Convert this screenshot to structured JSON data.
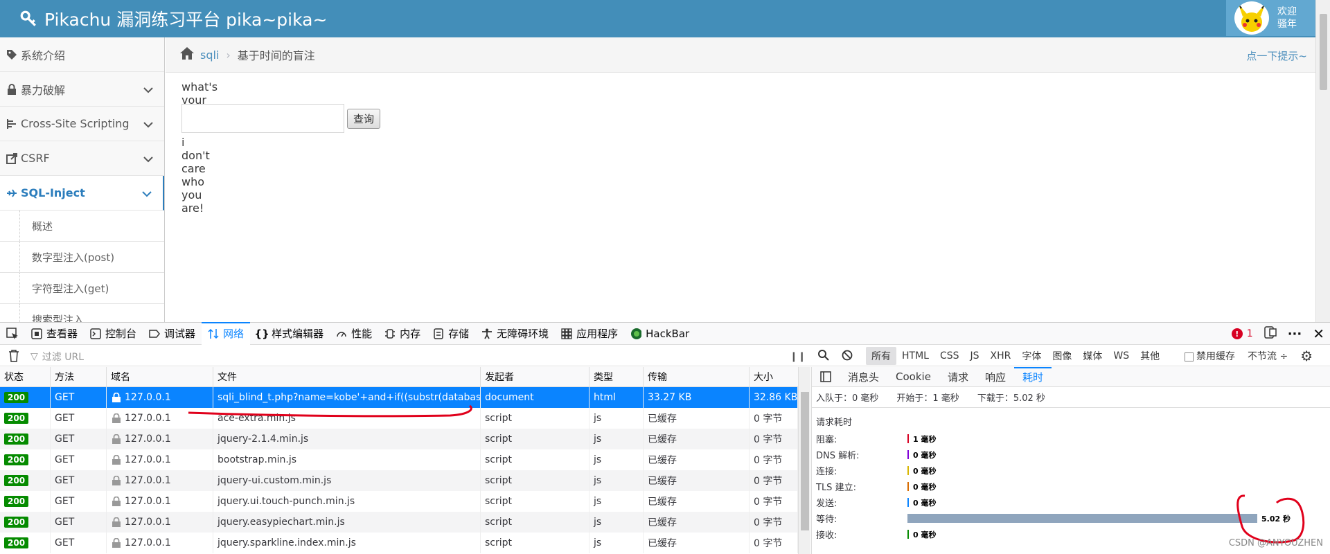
{
  "header": {
    "title": "Pikachu 漏洞练习平台 pika~pika~",
    "welcome": "欢迎",
    "username": "骚年"
  },
  "sidebar": {
    "items": [
      {
        "label": "系统介绍",
        "icon": "tags-icon"
      },
      {
        "label": "暴力破解",
        "icon": "lock-icon"
      },
      {
        "label": "Cross-Site Scripting",
        "icon": "list-icon"
      },
      {
        "label": "CSRF",
        "icon": "external-link-icon"
      },
      {
        "label": "SQL-Inject",
        "icon": "plane-icon"
      }
    ],
    "subitems": [
      "概述",
      "数字型注入(post)",
      "字符型注入(get)",
      "搜索型注入"
    ]
  },
  "breadcrumb": {
    "link": "sqli",
    "current": "基于时间的盲注",
    "hint": "点一下提示~"
  },
  "content": {
    "question": "what's your username?",
    "input_value": "",
    "button": "查询",
    "result": "i don't care who you are!"
  },
  "devtools": {
    "tabs": [
      "查看器",
      "控制台",
      "调试器",
      "网络",
      "样式编辑器",
      "性能",
      "内存",
      "存储",
      "无障碍环境",
      "应用程序",
      "HackBar"
    ],
    "active_tab": "网络",
    "error_count": "1",
    "filter_placeholder": "过滤 URL",
    "type_filters": [
      "所有",
      "HTML",
      "CSS",
      "JS",
      "XHR",
      "字体",
      "图像",
      "媒体",
      "WS",
      "其他"
    ],
    "disable_cache": "禁用缓存",
    "throttle": "不节流 ÷",
    "columns": [
      "状态",
      "方法",
      "域名",
      "文件",
      "发起者",
      "类型",
      "传输",
      "大小"
    ],
    "rows": [
      {
        "status": "200",
        "method": "GET",
        "domain": "127.0.0.1",
        "file": "sqli_blind_t.php?name=kobe'+and+if((substr(databas",
        "initiator": "document",
        "type": "html",
        "transfer": "33.27 KB",
        "size": "32.86 KB"
      },
      {
        "status": "200",
        "method": "GET",
        "domain": "127.0.0.1",
        "file": "ace-extra.min.js",
        "initiator": "script",
        "type": "js",
        "transfer": "已缓存",
        "size": "0 字节"
      },
      {
        "status": "200",
        "method": "GET",
        "domain": "127.0.0.1",
        "file": "jquery-2.1.4.min.js",
        "initiator": "script",
        "type": "js",
        "transfer": "已缓存",
        "size": "0 字节"
      },
      {
        "status": "200",
        "method": "GET",
        "domain": "127.0.0.1",
        "file": "bootstrap.min.js",
        "initiator": "script",
        "type": "js",
        "transfer": "已缓存",
        "size": "0 字节"
      },
      {
        "status": "200",
        "method": "GET",
        "domain": "127.0.0.1",
        "file": "jquery-ui.custom.min.js",
        "initiator": "script",
        "type": "js",
        "transfer": "已缓存",
        "size": "0 字节"
      },
      {
        "status": "200",
        "method": "GET",
        "domain": "127.0.0.1",
        "file": "jquery.ui.touch-punch.min.js",
        "initiator": "script",
        "type": "js",
        "transfer": "已缓存",
        "size": "0 字节"
      },
      {
        "status": "200",
        "method": "GET",
        "domain": "127.0.0.1",
        "file": "jquery.easypiechart.min.js",
        "initiator": "script",
        "type": "js",
        "transfer": "已缓存",
        "size": "0 字节"
      },
      {
        "status": "200",
        "method": "GET",
        "domain": "127.0.0.1",
        "file": "jquery.sparkline.index.min.js",
        "initiator": "script",
        "type": "js",
        "transfer": "已缓存",
        "size": "0 字节"
      }
    ],
    "panel": {
      "tabs": [
        "消息头",
        "Cookie",
        "请求",
        "响应",
        "耗时"
      ],
      "active_tab": "耗时",
      "summary": [
        "入队于：0 毫秒",
        "开始于：1 毫秒",
        "下载于：5.02 秒"
      ],
      "section_title": "请求耗时",
      "timings": [
        {
          "label": "阻塞:",
          "value": "1 毫秒",
          "color": "#d70022"
        },
        {
          "label": "DNS 解析:",
          "value": "0 毫秒",
          "color": "#8000d7"
        },
        {
          "label": "连接:",
          "value": "0 毫秒",
          "color": "#d7b600"
        },
        {
          "label": "TLS 建立:",
          "value": "0 毫秒",
          "color": "#d76b00"
        },
        {
          "label": "发送:",
          "value": "0 毫秒",
          "color": "#0a84ff"
        },
        {
          "label": "等待:",
          "value": "5.02 秒",
          "color": "#8fa5bd",
          "fraction": 1.0
        },
        {
          "label": "接收:",
          "value": "0 毫秒",
          "color": "#058b00"
        }
      ]
    }
  },
  "watermark": "CSDN @ANYOUZHEN"
}
